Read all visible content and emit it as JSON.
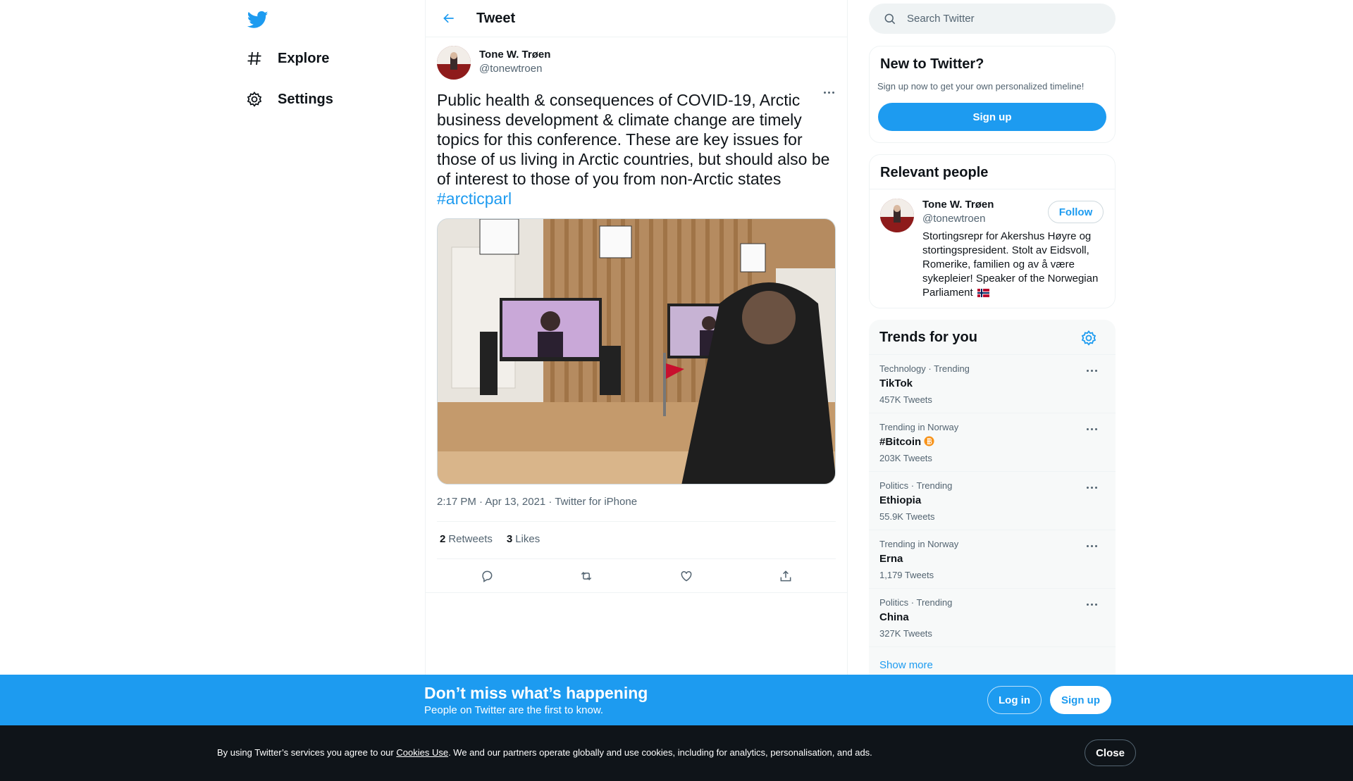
{
  "nav": {
    "explore_label": "Explore",
    "settings_label": "Settings"
  },
  "header": {
    "title": "Tweet"
  },
  "tweet": {
    "author_name": "Tone W. Trøen",
    "author_handle": "@tonewtroen",
    "text": "Public health & consequences of COVID-19, Arctic business development & climate change are timely topics for this conference. These are key issues for those of us living in Arctic countries, but should also be of interest to those of you from non-Arctic states",
    "hashtag": "#arcticparl",
    "meta": "2:17 PM · Apr 13, 2021 · Twitter for iPhone",
    "retweets_count": "2",
    "retweets_label": "Retweets",
    "likes_count": "3",
    "likes_label": "Likes"
  },
  "search": {
    "placeholder": "Search Twitter"
  },
  "new_to_twitter": {
    "title": "New to Twitter?",
    "subtitle": "Sign up now to get your own personalized timeline!",
    "signup_label": "Sign up"
  },
  "relevant_people": {
    "title": "Relevant people",
    "name": "Tone W. Trøen",
    "handle": "@tonewtroen",
    "follow_label": "Follow",
    "bio": "Stortingsrepr for Akershus Høyre og stortingspresident. Stolt av Eidsvoll, Romerike, familien og av å være sykepleier! Speaker of the Norwegian Parliament"
  },
  "trends": {
    "title": "Trends for you",
    "items": [
      {
        "context": "Technology · Trending",
        "name": "TikTok",
        "count": "457K Tweets"
      },
      {
        "context": "Trending in Norway",
        "name": "#Bitcoin",
        "count": "203K Tweets"
      },
      {
        "context": "Politics · Trending",
        "name": "Ethiopia",
        "count": "55.9K Tweets"
      },
      {
        "context": "Trending in Norway",
        "name": "Erna",
        "count": "1,179 Tweets"
      },
      {
        "context": "Politics · Trending",
        "name": "China",
        "count": "327K Tweets"
      }
    ],
    "show_more": "Show more"
  },
  "banner": {
    "title": "Don’t miss what’s happening",
    "subtitle": "People on Twitter are the first to know.",
    "login_label": "Log in",
    "signup_label": "Sign up"
  },
  "cookie": {
    "text_before": "By using Twitter’s services you agree to our ",
    "link": "Cookies Use",
    "text_after": ". We and our partners operate globally and use cookies, including for analytics, personalisation, and ads.",
    "close_label": "Close"
  },
  "colors": {
    "accent": "#1d9bf0",
    "text": "#0f1419",
    "secondary": "#536471",
    "cookie_bg": "#0f1419"
  }
}
